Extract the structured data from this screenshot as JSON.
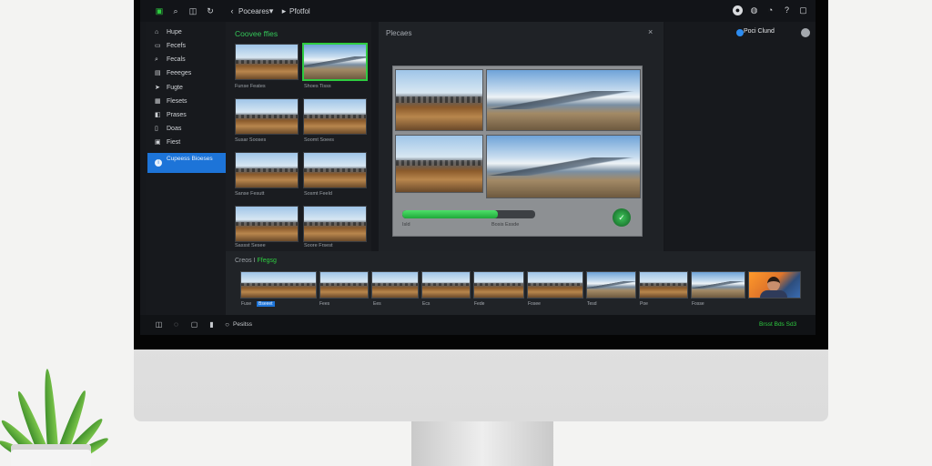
{
  "topbar": {
    "breadcrumb": [
      "Poceares",
      "Pfotfol"
    ],
    "right_icons": [
      "user-circle-icon",
      "globe-icon",
      "clock-icon",
      "help-icon",
      "window-icon"
    ]
  },
  "sidebar": {
    "items": [
      {
        "label": "Hupe",
        "icon": "home-icon"
      },
      {
        "label": "Fecefs",
        "icon": "folder-icon"
      },
      {
        "label": "Fecals",
        "icon": "search-icon"
      },
      {
        "label": "Feeeges",
        "icon": "files-icon"
      },
      {
        "label": "Fugte",
        "icon": "tag-icon"
      },
      {
        "label": "Flesets",
        "icon": "grid-icon"
      },
      {
        "label": "Prases",
        "icon": "layers-icon"
      },
      {
        "label": "Doas",
        "icon": "doc-icon"
      },
      {
        "label": "Fiest",
        "icon": "image-icon"
      },
      {
        "label": "Cupeess Bioeses",
        "icon": "info-icon",
        "active": true
      }
    ]
  },
  "files": {
    "title": "Coovee ffies",
    "thumbs": [
      {
        "caption": "Funse Feates",
        "selected": false
      },
      {
        "caption": "Shoes Tisss",
        "selected": true
      },
      {
        "caption": "",
        "selected": false
      },
      {
        "caption": "",
        "selected": false
      },
      {
        "caption": "Susar Sooses",
        "selected": false
      },
      {
        "caption": "Soomt Soees",
        "selected": false
      },
      {
        "caption": "Sanse Fesutt",
        "selected": false
      },
      {
        "caption": "Sosmt Feeld",
        "selected": false
      },
      {
        "caption": "Sassst Sesee",
        "selected": false
      },
      {
        "caption": "Soore Frsest",
        "selected": false
      }
    ]
  },
  "preview": {
    "title": "Plecaes",
    "progress": 0.72,
    "progress_label_left": "Isld",
    "progress_label_right": "Bosis Essde",
    "ok_icon": "check-icon"
  },
  "right_panel": {
    "cloud_label": "Poci Clund"
  },
  "timeline": {
    "title_prefix": "Creos I",
    "title_accent": "Ffegsg",
    "clip_captions": [
      "Fuse",
      "Bseeet",
      "Fees",
      "Ees",
      "Ecs",
      "Fede",
      "Fosee",
      "Tesd",
      "Poe",
      "Fosse",
      "",
      ""
    ]
  },
  "statusbar": {
    "label": "Pesitss",
    "right": "Brsst Bds Sd3"
  },
  "colors": {
    "accent_green": "#2ecc40",
    "accent_blue": "#1d74d8",
    "screen_bg": "#16181c"
  }
}
